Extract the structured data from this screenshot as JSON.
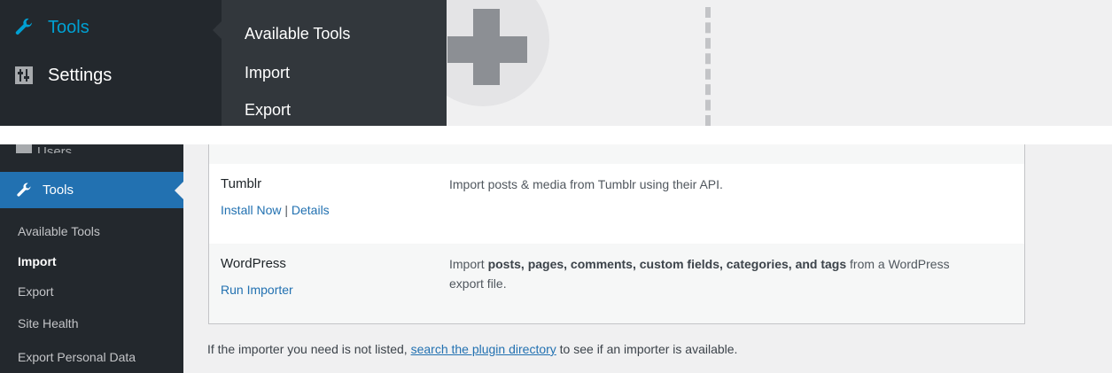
{
  "top_menu": {
    "tools_label": "Tools",
    "settings_label": "Settings",
    "flyout": [
      "Available Tools",
      "Import",
      "Export"
    ]
  },
  "side_menu": {
    "users_label": "Users",
    "tools_label": "Tools",
    "submenu": [
      "Available Tools",
      "Import",
      "Export",
      "Site Health",
      "Export Personal Data"
    ],
    "current": "Import"
  },
  "importers": [
    {
      "name": "Tumblr",
      "description": "Import posts & media from Tumblr using their API.",
      "action_install": "Install Now",
      "separator": "|",
      "action_details": "Details"
    },
    {
      "name": "WordPress",
      "description_pre": "Import ",
      "description_bold": "posts, pages, comments, custom fields, categories, and tags",
      "description_post_line1": " from a WordPress",
      "description_line2": "export file.",
      "action": "Run Importer"
    }
  ],
  "footnote": {
    "pre": "If the importer you need is not listed, ",
    "link": "search the plugin directory",
    "post": " to see if an importer is available."
  },
  "colors": {
    "menu_bg": "#23282d",
    "flyout_bg": "#32373c",
    "active_bg": "#2271b1",
    "link": "#2271b1",
    "tools_top": "#00a0d2"
  }
}
